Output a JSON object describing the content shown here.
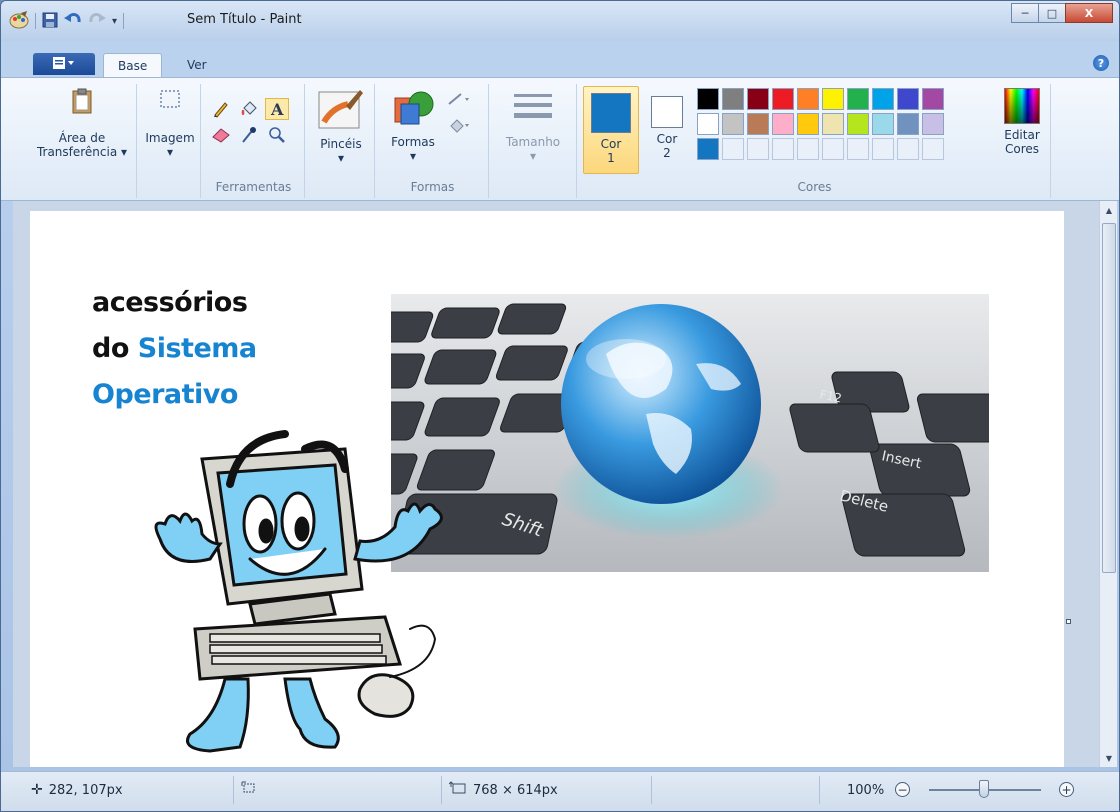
{
  "window": {
    "title": "Sem Título - Paint",
    "controls": {
      "minimize": "─",
      "maximize": "□",
      "close": "X"
    }
  },
  "tabs": [
    {
      "label": "Base",
      "active": true
    },
    {
      "label": "Ver",
      "active": false
    }
  ],
  "ribbon": {
    "clipboard": {
      "label_line1": "Área de",
      "label_line2": "Transferência"
    },
    "image": {
      "label": "Imagem"
    },
    "tools": {
      "group_label": "Ferramentas",
      "items": [
        "pencil-icon",
        "fill-icon",
        "text-icon",
        "eraser-icon",
        "color-picker-icon",
        "magnifier-icon"
      ]
    },
    "brushes": {
      "label": "Pincéis"
    },
    "shapes": {
      "label": "Formas",
      "group_label": "Formas"
    },
    "size": {
      "label": "Tamanho"
    },
    "colors": {
      "color1_line1": "Cor",
      "color1_line2": "1",
      "color1_value": "#1476c1",
      "color2_line1": "Cor",
      "color2_line2": "2",
      "color2_value": "#ffffff",
      "edit_line1": "Editar",
      "edit_line2": "Cores",
      "group_label": "Cores",
      "palette": [
        "#000000",
        "#7f7f7f",
        "#880015",
        "#ed1c24",
        "#ff7f27",
        "#fff200",
        "#22b14c",
        "#00a2e8",
        "#3f48cc",
        "#a349a4",
        "#ffffff",
        "#c3c3c3",
        "#b97a57",
        "#ffaec9",
        "#ffc90e",
        "#efe4b0",
        "#b5e61d",
        "#99d9ea",
        "#7092be",
        "#c8bfe7",
        "#1476c1",
        "",
        "",
        "",
        "",
        "",
        "",
        "",
        "",
        ""
      ]
    }
  },
  "canvas": {
    "text_line1": "acessórios",
    "text_line2_a": "do ",
    "text_line2_b": "Sistema",
    "text_line3": "Operativo",
    "keyboard_labels": {
      "shift": "Shift",
      "delete": "Delete",
      "insert": "Insert",
      "f12": "F12"
    }
  },
  "status": {
    "cursor_pos": "282, 107px",
    "image_size": "768 × 614px",
    "zoom": "100%"
  }
}
